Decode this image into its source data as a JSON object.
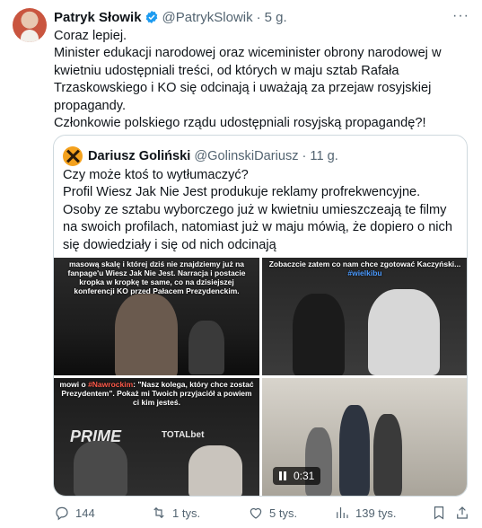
{
  "tweet": {
    "author_name": "Patryk Słowik",
    "handle": "@PatrykSlowik",
    "separator": "·",
    "time": "5 g.",
    "more": "···",
    "lines": [
      "Coraz lepiej.",
      "Minister edukacji narodowej oraz wiceminister obrony narodowej w kwietniu udostępniali treści, od których w maju sztab Rafała Trzaskowskiego i KO się odcinają i uważają za przejaw rosyjskiej propagandy.",
      "Członkowie polskiego rządu udostępniali rosyjską propagandę?!"
    ]
  },
  "quote": {
    "author_name": "Dariusz Goliński",
    "handle": "@GolinskiDariusz",
    "separator": "·",
    "time": "11 g.",
    "lines": [
      "Czy może ktoś to wytłumaczyć?",
      "Profil Wiesz Jak Nie Jest produkuje reklamy profrekwencyjne.",
      "Osoby ze sztabu wyborczego już w kwietniu umieszczeają te filmy na swoich profilach, natomiast już w maju mówią, że dopiero o nich się dowiedziały i się od nich odcinają"
    ],
    "media": {
      "img1_caption": "masową skalę i której dziś nie znajdziemy już na fanpage'u Wiesz Jak Nie Jest. Narracja i postacie kropka w kropkę te same, co na dzisiejszej konferencji KO przed Pałacem Prezydenckim.",
      "img2_caption": "Zobaczcie zatem co nam chce zgotować Kaczyński...",
      "img2_tag": "#wielkibu",
      "img3_caption_prefix": "mowi o ",
      "img3_caption_highlight": "#Nawrockim",
      "img3_caption_rest": ": \"Nasz kolega, który chce zostać Prezydentem\". Pokaż mi Twoich przyjaciół a powiem ci kim jesteś.",
      "img3_brand": "PRIME",
      "img3_sponsor": "TOTALbet",
      "video_duration": "0:31"
    }
  },
  "actions": {
    "replies": "144",
    "reposts": "1 tys.",
    "likes": "5 tys.",
    "views": "139 tys."
  },
  "colors": {
    "text": "#0f1419",
    "secondary": "#536471",
    "verified": "#1d9bf0",
    "border": "#cfd9de"
  }
}
